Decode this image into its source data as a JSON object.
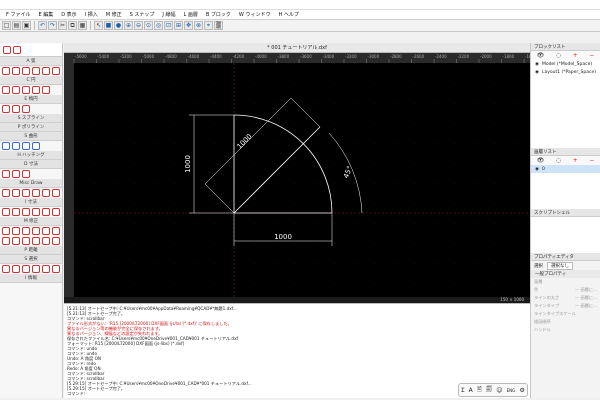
{
  "menus": [
    "F ファイル",
    "E 編集",
    "D 表示",
    "I 挿入",
    "M 修正",
    "S スナップ",
    "J 線幅",
    "L 画層",
    "B ブロック",
    "W ウィンドウ",
    "H ヘルプ"
  ],
  "document_tab": "* 001 チュートリアル.dxf",
  "left_panel": {
    "sections": [
      "A 弧",
      "C 円",
      "E 楕円",
      "S スプライン",
      "P ポリライン",
      "S 曲形",
      "H ハッチング",
      "D 寸法",
      "Misc Draw",
      "I 寸法",
      "M 修正",
      "P 距離",
      "S 選択",
      "I 情報"
    ]
  },
  "ruler_ticks": [
    "-5600",
    "-5400",
    "-5200",
    "-5000",
    "-4800",
    "-4600",
    "-4400",
    "-4200",
    "-4000",
    "-3800",
    "-3600",
    "-3400",
    "-3200",
    "-3000",
    "-2800",
    "-2600",
    "-2400",
    "-2200",
    "-2000",
    "-1800",
    "-1600"
  ],
  "drawing": {
    "dim_vertical": "1000",
    "dim_horizontal": "1000",
    "dim_aligned": "1000",
    "dim_angle": "45°"
  },
  "status_coords": "150 × 1000",
  "command_lines": [
    {
      "text": "[5.21:13] オートセーブ中: C:¥Users¥mc00¥AppData¥Roaming¥QCAD¥*無題1.dxf...",
      "red": false
    },
    {
      "text": "[5.21:13] オートセーブ完了。",
      "red": false
    },
    {
      "text": "コマンド: scrollbar",
      "red": false
    },
    {
      "text": "ファイル形式がない：'R15 [2000/LT2000] DXF図面 (js/la) (*.dxf)' に保存しました。",
      "red": true
    },
    {
      "text": "異なるバージョン等の機能が完全に保存されます。",
      "red": true
    },
    {
      "text": "異なるバージョン、線幅などの設定が失われます。",
      "red": true
    },
    {
      "text": "保存されたファイル名: C:¥Users¥mc00¥OneDrive¥001_CAD¥001 チュートリアル.dxf",
      "red": false
    },
    {
      "text": "フォーマット: R15 [2000/LT2000] DXF図面 (js-libs) (*.dxf)",
      "red": false
    },
    {
      "text": "コマンド: undo",
      "red": false
    },
    {
      "text": "コマンド: undo",
      "red": false
    },
    {
      "text": "Undo: A 角度 ON",
      "red": false
    },
    {
      "text": "コマンド: redo",
      "red": false
    },
    {
      "text": "Redo: A 角度 ON",
      "red": false
    },
    {
      "text": "コマンド: scrollbar",
      "red": false
    },
    {
      "text": "コマンド: scrollbar",
      "red": false
    },
    {
      "text": "[5.29:15] オートセーブ中: C:¥Users¥mc00¥OneDrive¥001_CAD¥*001 チュートリアル.dxf...",
      "red": false
    },
    {
      "text": "[5.29:15] オートセーブ完了。",
      "red": false
    }
  ],
  "command_prompt_label": "コマンド:",
  "right_panel": {
    "blocks_title": "ブロックリスト",
    "blocks": [
      "Model (*Model_Space)",
      "Layout1 (*Paper_Space)"
    ],
    "layers_title": "画層リスト",
    "layers": [
      "0"
    ],
    "scripts_title": "スクリプトシェル",
    "props_title": "プロパティエディタ",
    "select_label": "選択",
    "select_value": "選択なし",
    "general_props": "一般プロパティ",
    "props": [
      {
        "label": "画層",
        "value": ""
      },
      {
        "label": "色",
        "value": "— 画層に..."
      },
      {
        "label": "ラインの太さ",
        "value": "— 画層に..."
      },
      {
        "label": "ラインタイプ",
        "value": "— 画層に..."
      },
      {
        "label": "ラインタイプスケール",
        "value": ""
      },
      {
        "label": "描画順序",
        "value": ""
      },
      {
        "label": "ハンドル",
        "value": ""
      }
    ]
  },
  "floatbar_glyphs": [
    "Ɪ",
    "A",
    "🖹",
    "🗐",
    "☺",
    "ENG",
    "⚙"
  ],
  "colors": {
    "canvas": "#000000",
    "entity": "#ffffff",
    "crosshair": "#ff3030"
  }
}
